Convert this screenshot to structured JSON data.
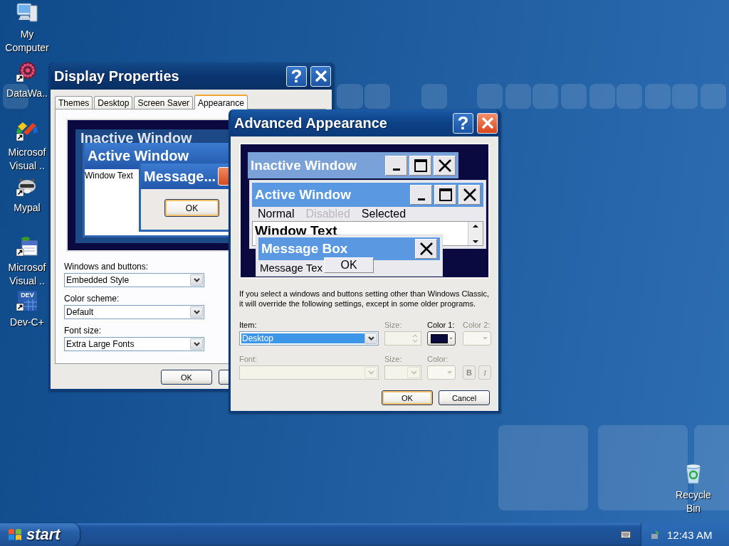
{
  "desktop": {
    "icons": [
      {
        "label": "My Computer",
        "kind": "computer",
        "shortcut": false
      },
      {
        "label": "DataWa..",
        "kind": "sphere",
        "shortcut": true
      },
      {
        "label": "Microsof Visual ..",
        "kind": "blocks",
        "shortcut": true
      },
      {
        "label": "Mypal",
        "kind": "raccoon",
        "shortcut": true
      },
      {
        "label": "Microsof Visual ..",
        "kind": "calendar",
        "shortcut": true
      },
      {
        "label": "Dev-C+",
        "kind": "dev",
        "shortcut": true,
        "badge": "DEV"
      }
    ],
    "recycle_bin": {
      "label": "Recycle Bin"
    }
  },
  "display_properties": {
    "title": "Display Properties",
    "active": false,
    "help": "?",
    "tabs": [
      {
        "label": "Themes",
        "selected": false
      },
      {
        "label": "Desktop",
        "selected": false
      },
      {
        "label": "Screen Saver",
        "selected": false
      },
      {
        "label": "Appearance",
        "selected": true
      }
    ],
    "preview": {
      "inactive_title": "Inactive Window",
      "active_title": "Active Window",
      "window_text": "Window Text",
      "message_title": "Message...",
      "ok": "OK"
    },
    "fields": [
      {
        "label": "Windows and buttons:",
        "value": "Embedded Style"
      },
      {
        "label": "Color scheme:",
        "value": "Default"
      },
      {
        "label": "Font size:",
        "value": "Extra Large Fonts"
      }
    ],
    "buttons": [
      "OK"
    ]
  },
  "advanced_appearance": {
    "title": "Advanced Appearance",
    "active": true,
    "help": "?",
    "preview": {
      "inactive_title": "Inactive Window",
      "active_title": "Active Window",
      "menu": [
        {
          "label": "Normal",
          "kind": "normal"
        },
        {
          "label": "Disabled",
          "kind": "disabled"
        },
        {
          "label": "Selected",
          "kind": "selected"
        }
      ],
      "window_text": "Window Text",
      "message_title": "Message Box",
      "message_text": "Message Tex",
      "ok": "OK"
    },
    "note": "If you select a windows and buttons setting other than Windows Classic,\nit will override the following settings, except in some older programs.",
    "controls": [
      {
        "label": "Item:",
        "kind": "combo",
        "value": "Desktop",
        "disabled": false
      },
      {
        "label": "Size:",
        "kind": "spinner",
        "disabled": true
      },
      {
        "label": "Color 1:",
        "kind": "color",
        "color": "#0a0a3c",
        "disabled": false
      },
      {
        "label": "Color 2:",
        "kind": "color",
        "disabled": true
      },
      {
        "label": "Font:",
        "kind": "combo",
        "disabled": true
      },
      {
        "label": "Size:",
        "kind": "combo",
        "disabled": true
      },
      {
        "label": "Color:",
        "kind": "color",
        "disabled": true
      },
      {
        "kind": "style_buttons",
        "buttons": [
          "B",
          "I"
        ],
        "disabled": true
      }
    ],
    "buttons": [
      "OK",
      "Cancel"
    ]
  },
  "taskbar": {
    "start": "start",
    "clock": "12:43 AM"
  }
}
